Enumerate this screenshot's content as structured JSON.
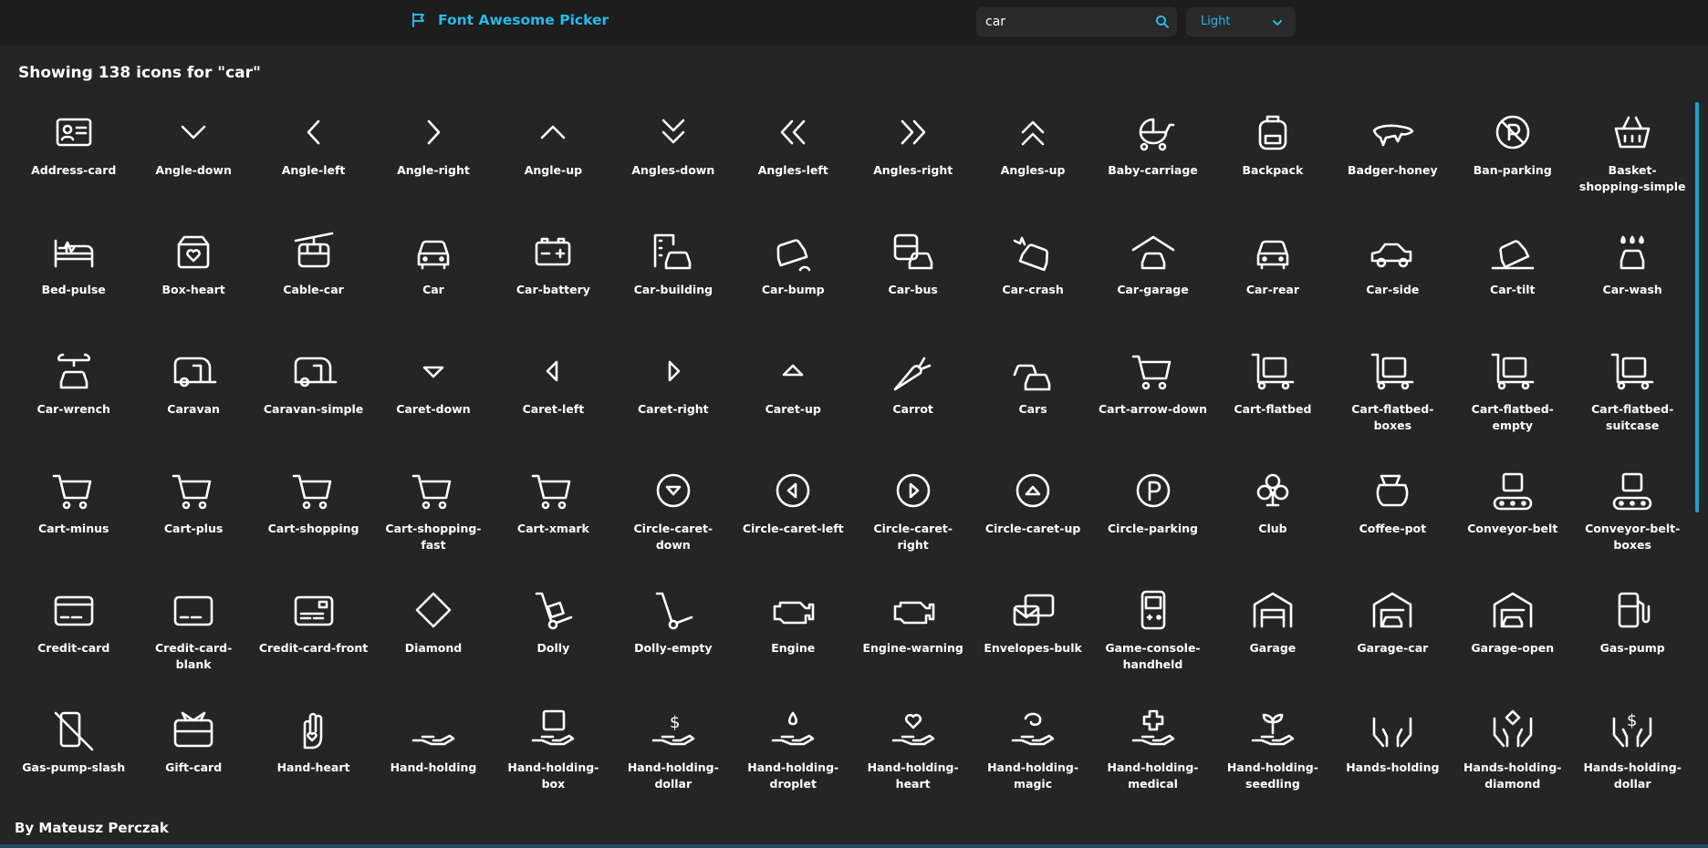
{
  "header": {
    "title": "Font Awesome Picker",
    "logo_icon": "flag-icon",
    "search": {
      "value": "car",
      "placeholder": "",
      "icon": "search-icon"
    },
    "theme_select": {
      "value": "Light",
      "icon": "chevron-down-icon"
    }
  },
  "results": {
    "heading": "Showing 138 icons for \"car\"",
    "icons": [
      "Address-card",
      "Angle-down",
      "Angle-left",
      "Angle-right",
      "Angle-up",
      "Angles-down",
      "Angles-left",
      "Angles-right",
      "Angles-up",
      "Baby-carriage",
      "Backpack",
      "Badger-honey",
      "Ban-parking",
      "Basket-shopping-simple",
      "Bed-pulse",
      "Box-heart",
      "Cable-car",
      "Car",
      "Car-battery",
      "Car-building",
      "Car-bump",
      "Car-bus",
      "Car-crash",
      "Car-garage",
      "Car-rear",
      "Car-side",
      "Car-tilt",
      "Car-wash",
      "Car-wrench",
      "Caravan",
      "Caravan-simple",
      "Caret-down",
      "Caret-left",
      "Caret-right",
      "Caret-up",
      "Carrot",
      "Cars",
      "Cart-arrow-down",
      "Cart-flatbed",
      "Cart-flatbed-boxes",
      "Cart-flatbed-empty",
      "Cart-flatbed-suitcase",
      "Cart-minus",
      "Cart-plus",
      "Cart-shopping",
      "Cart-shopping-fast",
      "Cart-xmark",
      "Circle-caret-down",
      "Circle-caret-left",
      "Circle-caret-right",
      "Circle-caret-up",
      "Circle-parking",
      "Club",
      "Coffee-pot",
      "Conveyor-belt",
      "Conveyor-belt-boxes",
      "Credit-card",
      "Credit-card-blank",
      "Credit-card-front",
      "Diamond",
      "Dolly",
      "Dolly-empty",
      "Engine",
      "Engine-warning",
      "Envelopes-bulk",
      "Game-console-handheld",
      "Garage",
      "Garage-car",
      "Garage-open",
      "Gas-pump",
      "Gas-pump-slash",
      "Gift-card",
      "Hand-heart",
      "Hand-holding",
      "Hand-holding-box",
      "Hand-holding-dollar",
      "Hand-holding-droplet",
      "Hand-holding-heart",
      "Hand-holding-magic",
      "Hand-holding-medical",
      "Hand-holding-seedling",
      "Hands-holding",
      "Hands-holding-diamond",
      "Hands-holding-dollar"
    ]
  },
  "footer": {
    "author": "By Mateusz Perczak"
  },
  "colors": {
    "accent": "#29b8e8",
    "background": "#252525",
    "header": "#1d1d1d"
  }
}
